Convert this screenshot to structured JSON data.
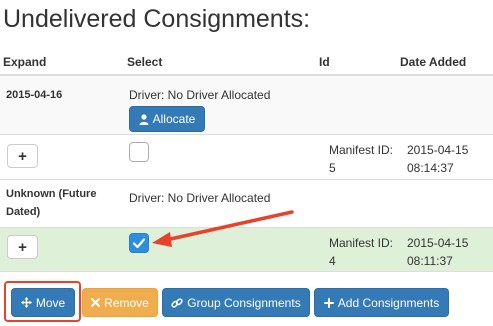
{
  "page": {
    "title": "Undelivered Consignments:"
  },
  "table": {
    "headers": {
      "expand": "Expand",
      "select": "Select",
      "id": "Id",
      "date_added": "Date Added"
    },
    "groups": [
      {
        "label": "2015-04-16",
        "driver": "Driver: No Driver Allocated",
        "allocate_label": "Allocate",
        "row": {
          "expand_label": "+",
          "checked": false,
          "id": "Manifest ID: 5",
          "date": "2015-04-15 08:14:37"
        }
      },
      {
        "label": "Unknown (Future Dated)",
        "driver": "Driver: No Driver Allocated",
        "row": {
          "expand_label": "+",
          "checked": true,
          "id": "Manifest ID: 4",
          "date": "2015-04-15 08:11:37"
        }
      }
    ]
  },
  "toolbar": {
    "move_label": "Move",
    "remove_label": "Remove",
    "group_label": "Group Consignments",
    "add_label": "Add Consignments"
  },
  "colors": {
    "primary": "#337ab7",
    "warning": "#f0ad4e",
    "highlight_row": "#dff0d8",
    "group_row": "#f9f9f9",
    "annotation_red": "#e8412c",
    "checkbox_checked": "#2e8ede"
  },
  "icons": {
    "allocate": "user-icon",
    "move": "move-arrows-icon",
    "remove": "close-icon",
    "group": "link-icon",
    "add": "plus-icon",
    "checkbox": "check-icon"
  }
}
